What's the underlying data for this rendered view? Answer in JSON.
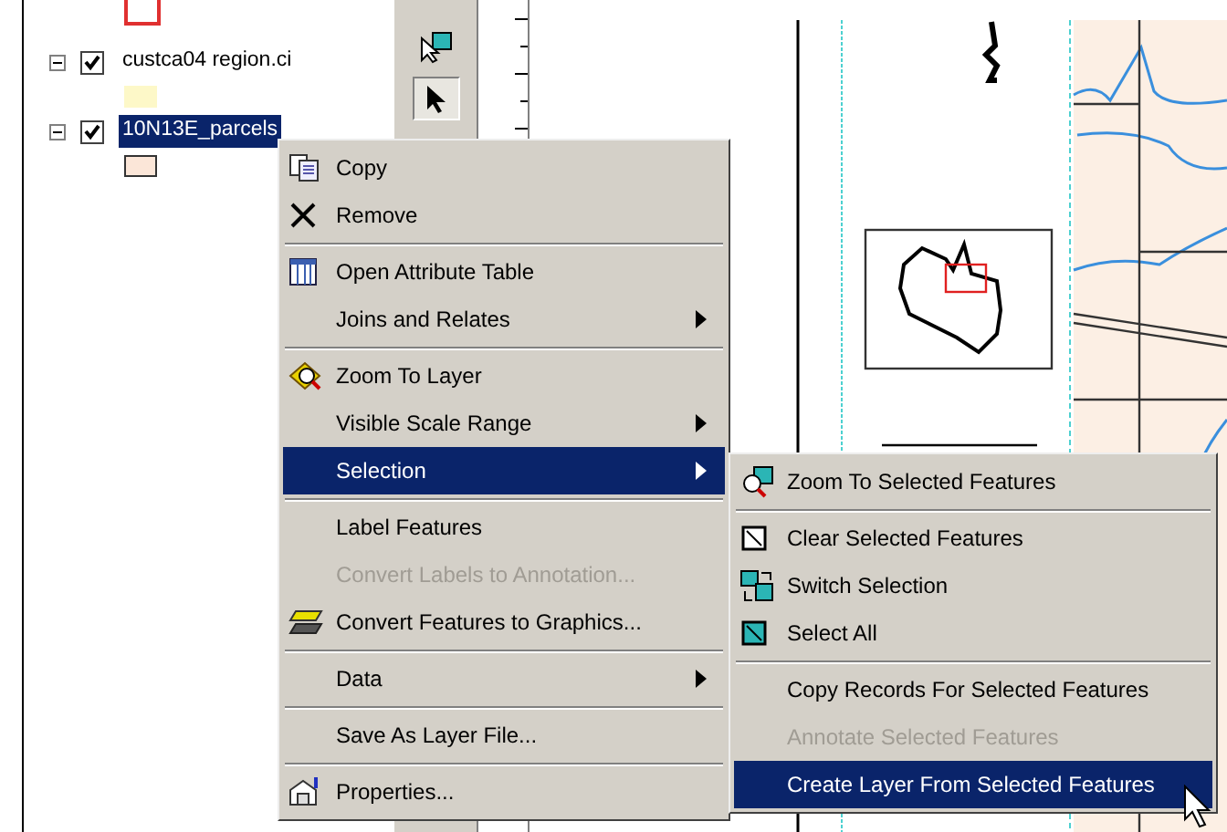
{
  "toc": {
    "top_patch": {
      "color": "#e03030"
    },
    "layers": [
      {
        "name": "custca04 region.ci",
        "expanded": true,
        "checked": true,
        "selected": false,
        "color": "#fdf8c8"
      },
      {
        "name": "10N13E_parcels",
        "expanded": true,
        "checked": true,
        "selected": true,
        "color": "#fbe6d8"
      }
    ]
  },
  "tools": [
    {
      "selected": false
    },
    {
      "selected": true
    }
  ],
  "context_menu": {
    "items": [
      {
        "kind": "item",
        "label": "Copy",
        "disabled": false,
        "selected": false,
        "has_submenu": false
      },
      {
        "kind": "item",
        "label": "Remove",
        "disabled": false,
        "selected": false,
        "has_submenu": false
      },
      {
        "kind": "separator"
      },
      {
        "kind": "item",
        "label": "Open Attribute Table",
        "disabled": false,
        "selected": false,
        "has_submenu": false
      },
      {
        "kind": "item",
        "label": "Joins and Relates",
        "disabled": false,
        "selected": false,
        "has_submenu": true
      },
      {
        "kind": "separator"
      },
      {
        "kind": "item",
        "label": "Zoom To Layer",
        "disabled": false,
        "selected": false,
        "has_submenu": false
      },
      {
        "kind": "item",
        "label": "Visible Scale Range",
        "disabled": false,
        "selected": false,
        "has_submenu": true
      },
      {
        "kind": "item",
        "label": "Selection",
        "disabled": false,
        "selected": true,
        "has_submenu": true
      },
      {
        "kind": "separator"
      },
      {
        "kind": "item",
        "label": "Label Features",
        "disabled": false,
        "selected": false,
        "has_submenu": false
      },
      {
        "kind": "item",
        "label": "Convert Labels to Annotation...",
        "disabled": true,
        "selected": false,
        "has_submenu": false
      },
      {
        "kind": "item",
        "label": "Convert Features to Graphics...",
        "disabled": false,
        "selected": false,
        "has_submenu": false
      },
      {
        "kind": "separator"
      },
      {
        "kind": "item",
        "label": "Data",
        "disabled": false,
        "selected": false,
        "has_submenu": true
      },
      {
        "kind": "separator"
      },
      {
        "kind": "item",
        "label": "Save As Layer File...",
        "disabled": false,
        "selected": false,
        "has_submenu": false
      },
      {
        "kind": "separator"
      },
      {
        "kind": "item",
        "label": "Properties...",
        "disabled": false,
        "selected": false,
        "has_submenu": false
      }
    ]
  },
  "submenu": {
    "items": [
      {
        "kind": "item",
        "label": "Zoom To Selected Features",
        "disabled": false,
        "selected": false
      },
      {
        "kind": "separator"
      },
      {
        "kind": "item",
        "label": "Clear Selected Features",
        "disabled": false,
        "selected": false
      },
      {
        "kind": "item",
        "label": "Switch Selection",
        "disabled": false,
        "selected": false
      },
      {
        "kind": "item",
        "label": "Select All",
        "disabled": false,
        "selected": false
      },
      {
        "kind": "separator"
      },
      {
        "kind": "item",
        "label": "Copy Records For Selected Features",
        "disabled": false,
        "selected": false
      },
      {
        "kind": "item",
        "label": "Annotate Selected Features",
        "disabled": true,
        "selected": false
      },
      {
        "kind": "item",
        "label": "Create Layer From Selected Features",
        "disabled": false,
        "selected": true
      }
    ]
  }
}
